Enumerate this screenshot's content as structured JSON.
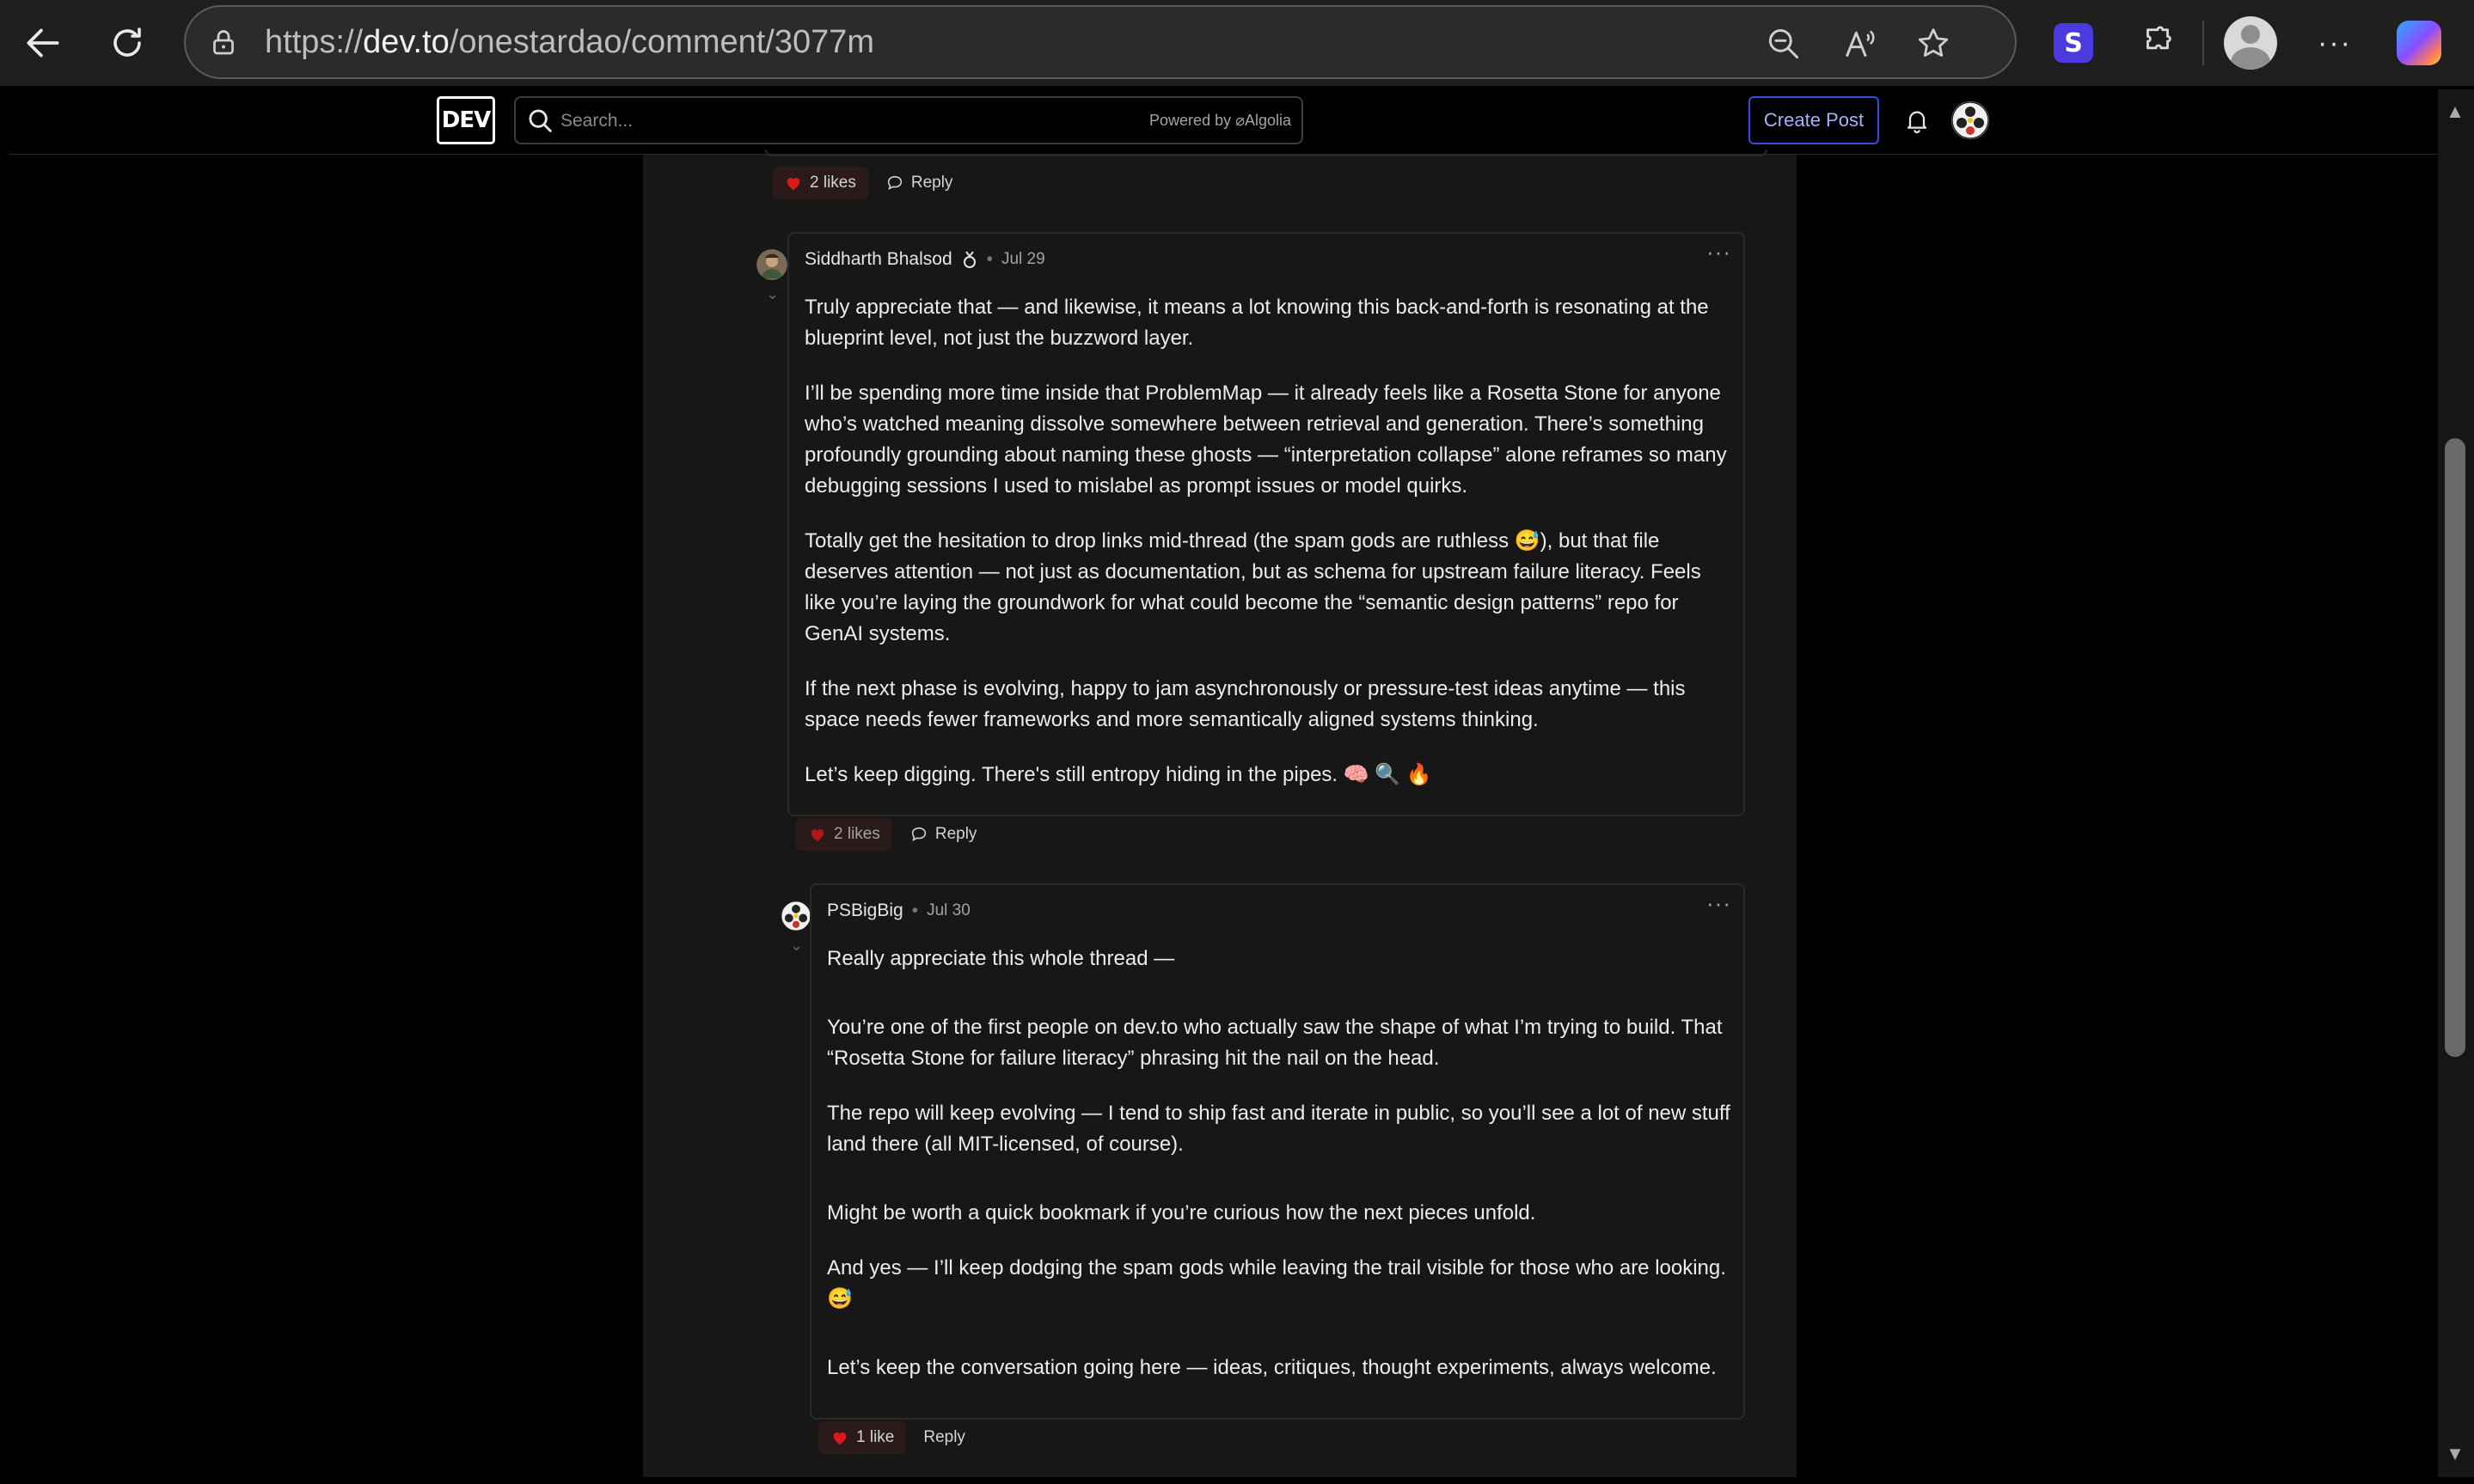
{
  "browser": {
    "url_prefix": "https://",
    "url_host": "dev.to",
    "url_path": "/onestardao/comment/3077m"
  },
  "header": {
    "logo": "DEV",
    "search_placeholder": "Search...",
    "powered_by": "Powered by",
    "algolia": "Algolia",
    "create_post": "Create Post"
  },
  "prev_actions": {
    "likes": "2 likes",
    "reply": "Reply"
  },
  "comments": [
    {
      "author": "Siddharth Bhalsod",
      "date": "Jul 29",
      "paragraphs": [
        "Truly appreciate that — and likewise, it means a lot knowing this back-and-forth is resonating at the blueprint level, not just the buzzword layer.",
        "I’ll be spending more time inside that ProblemMap — it already feels like a Rosetta Stone for anyone who’s watched meaning dissolve somewhere between retrieval and generation. There’s something profoundly grounding about naming these ghosts — “interpretation collapse” alone reframes so many debugging sessions I used to mislabel as prompt issues or model quirks.",
        "Totally get the hesitation to drop links mid-thread (the spam gods are ruthless 😅), but that file deserves attention — not just as documentation, but as schema for upstream failure literacy. Feels like you’re laying the groundwork for what could become the “semantic design patterns” repo for GenAI systems.",
        "If the next phase is evolving, happy to jam asynchronously or pressure-test ideas anytime — this space needs fewer frameworks and more semantically aligned systems thinking.",
        "Let’s keep digging. There's still entropy hiding in the pipes. 🧠 🔍 🔥"
      ],
      "likes": "2 likes",
      "reply": "Reply"
    },
    {
      "author": "PSBigBig",
      "date": "Jul 30",
      "paragraphs": [
        "Really appreciate this whole thread —",
        "You’re one of the first people on dev.to who actually saw the shape of what I’m trying to build. That “Rosetta Stone for failure literacy” phrasing hit the nail on the head.",
        "The repo will keep evolving — I tend to ship fast and iterate in public, so you’ll see a lot of new stuff land there (all MIT-licensed, of course).",
        "Might be worth a quick bookmark if you’re curious how the next pieces unfold.",
        "And yes — I’ll keep dodging the spam gods while leaving the trail visible for those who are looking. 😅",
        "Let’s keep the conversation going here — ideas, critiques, thought experiments, always welcome."
      ],
      "likes": "1 like",
      "reply": "Reply"
    }
  ],
  "colors": {
    "accent": "#3b49df",
    "heart": "#dc1818",
    "background": "#000000",
    "card": "#171717"
  }
}
